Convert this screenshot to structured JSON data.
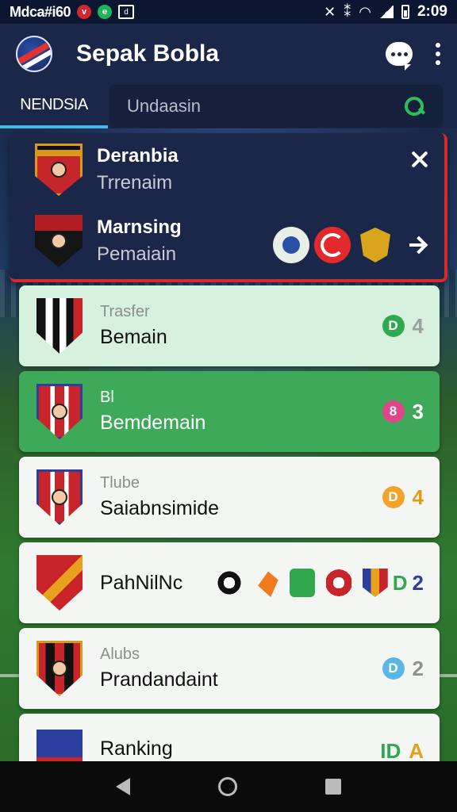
{
  "status_bar": {
    "carrier": "Mdca#i60",
    "time": "2:09",
    "icons": [
      "notification-red-icon",
      "notification-green-icon",
      "notification-box-icon",
      "mute-icon",
      "vibrate-icon",
      "wifi-icon",
      "signal-icon",
      "battery-icon"
    ]
  },
  "app": {
    "title": "Sepak Bobla"
  },
  "tabs": {
    "active": "NENDSIA"
  },
  "search": {
    "placeholder": "Undaasin"
  },
  "popup": {
    "row1": {
      "name": "Deranbia",
      "sub": "Trrenaim"
    },
    "row2": {
      "name": "Marnsing",
      "sub": "Pemaiain"
    }
  },
  "list": [
    {
      "category": "Trasfer",
      "title": "Bemain",
      "badge": "D",
      "badge_color": "#2fa84f",
      "value": "4",
      "value_color": "#9aa09c",
      "style": "mint"
    },
    {
      "category": "Bl",
      "title": "Bemdemain",
      "badge": "8",
      "badge_color": "#e0458c",
      "value": "3",
      "value_color": "#ffffff",
      "style": "green"
    },
    {
      "category": "Tlube",
      "title": "Saiabnsimide",
      "badge": "D",
      "badge_color": "#f1a32c",
      "value": "4",
      "value_color": "#e09b1c",
      "style": "white"
    },
    {
      "category": "",
      "title": "PahNilNc",
      "badge": "D",
      "badge_color": "",
      "value": "2",
      "value_color": "#2a3fa0",
      "style": "white"
    },
    {
      "category": "Alubs",
      "title": "Prandandaint",
      "badge": "D",
      "badge_color": "#5ab6e6",
      "value": "2",
      "value_color": "#8e938f",
      "style": "white"
    },
    {
      "category": "",
      "title": "Ranking",
      "badge": "ID",
      "badge_color": "",
      "value": "A",
      "value_color": "#e0a21c",
      "style": "white"
    }
  ],
  "colors": {
    "appbar": "#1a2748",
    "accent_green": "#2fbf5a",
    "accent_red": "#d42a2a"
  }
}
